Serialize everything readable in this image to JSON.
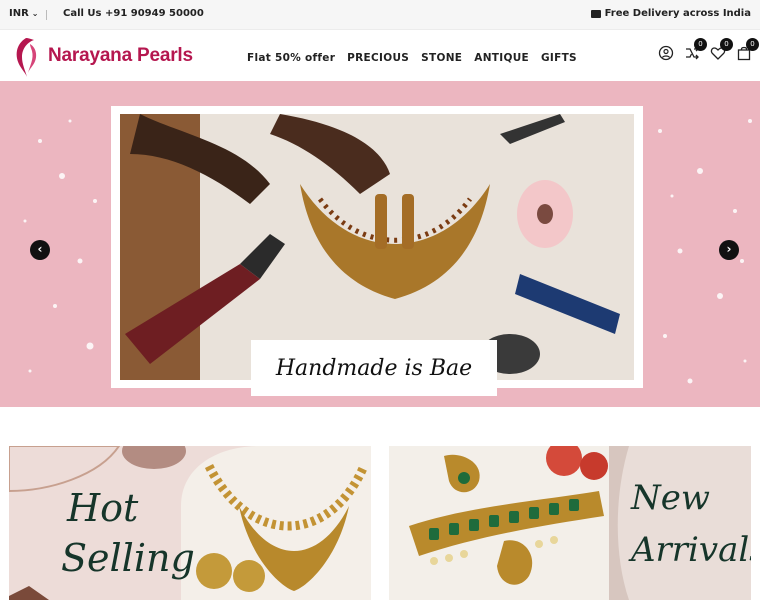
{
  "topbar": {
    "currency": "INR",
    "phone": "Call Us +91 90949 50000",
    "delivery": "Free Delivery across India"
  },
  "header": {
    "brand": "Narayana Pearls",
    "nav": [
      "Flat 50% offer",
      "PRECIOUS",
      "STONE",
      "ANTIQUE",
      "GIFTS"
    ],
    "compare_count": "0",
    "wishlist_count": "0",
    "cart_count": "0"
  },
  "hero": {
    "caption": "Handmade is Bae",
    "prev_arrow": "‹",
    "next_arrow": "›"
  },
  "promos": {
    "hot": [
      "Hot",
      "Selling"
    ],
    "new": [
      "New",
      "Arrivals"
    ]
  },
  "colors": {
    "brand": "#b5174f",
    "hero_bg": "#ecb6c0",
    "dark": "#111111"
  }
}
